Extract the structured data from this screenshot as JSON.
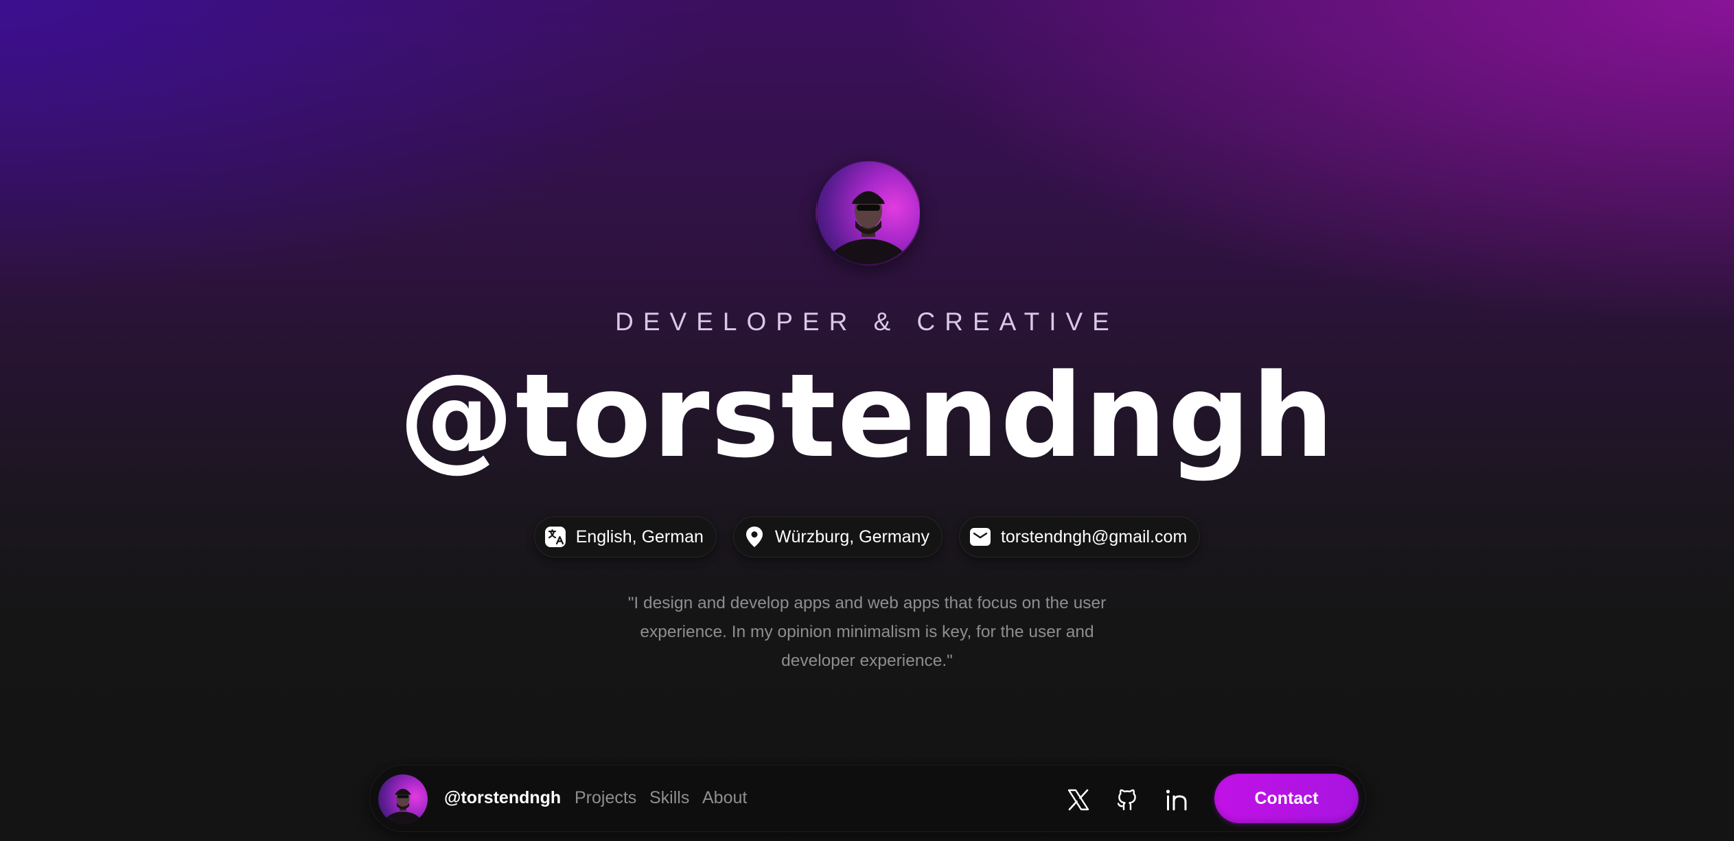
{
  "hero": {
    "subtitle": "DEVELOPER & CREATIVE",
    "handle": "@torstendngh",
    "avatar_icon": "profile-photo"
  },
  "chips": {
    "languages": {
      "label": "English, German",
      "icon": "language-icon"
    },
    "location": {
      "label": "Würzburg, Germany",
      "icon": "location-pin-icon"
    },
    "email": {
      "label": "torstendngh@gmail.com",
      "icon": "mail-icon"
    }
  },
  "quote": {
    "line1": "\"I design and develop apps and web apps that focus on the user",
    "line2": "experience. In my opinion minimalism is key, for the user and",
    "line3": "developer experience.\""
  },
  "navbar": {
    "handle": "@torstendngh",
    "links": {
      "projects": "Projects",
      "skills": "Skills",
      "about": "About"
    },
    "socials": [
      "x-icon",
      "github-icon",
      "linkedin-icon"
    ],
    "contact_label": "Contact"
  },
  "colors": {
    "accent": "#c112e6",
    "background": "#141414",
    "gradient_purple": "#3c0f96",
    "gradient_magenta": "#9614a0"
  }
}
